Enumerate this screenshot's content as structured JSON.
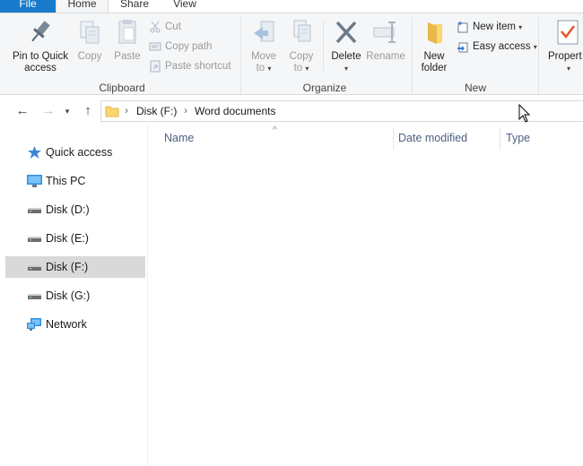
{
  "tabs": {
    "file": "File",
    "home": "Home",
    "share": "Share",
    "view": "View"
  },
  "clipboard": {
    "group_label": "Clipboard",
    "pin_label_1": "Pin to Quick",
    "pin_label_2": "access",
    "copy": "Copy",
    "paste": "Paste",
    "cut": "Cut",
    "copy_path": "Copy path",
    "paste_shortcut": "Paste shortcut"
  },
  "organize": {
    "group_label": "Organize",
    "move_to_1": "Move",
    "move_to_2": "to",
    "copy_to_1": "Copy",
    "copy_to_2": "to",
    "delete": "Delete",
    "rename": "Rename"
  },
  "new_group": {
    "group_label": "New",
    "new_folder_1": "New",
    "new_folder_2": "folder",
    "new_item": "New item",
    "easy_access": "Easy access"
  },
  "open_group": {
    "properties": "Propert"
  },
  "address": {
    "crumbs": [
      "Disk (F:)",
      "Word documents"
    ]
  },
  "navpane": {
    "items": [
      {
        "label": "Quick access",
        "icon": "star-icon"
      },
      {
        "label": "This PC",
        "icon": "monitor-icon"
      },
      {
        "label": "Disk (D:)",
        "icon": "drive-icon"
      },
      {
        "label": "Disk (E:)",
        "icon": "drive-icon"
      },
      {
        "label": "Disk (F:)",
        "icon": "drive-icon",
        "selected": true
      },
      {
        "label": "Disk (G:)",
        "icon": "drive-icon"
      },
      {
        "label": "Network",
        "icon": "network-icon"
      }
    ]
  },
  "columns": {
    "name": "Name",
    "date_modified": "Date modified",
    "type": "Type"
  },
  "colors": {
    "file_tab": "#1979ca",
    "selected_row": "#d9d9d9",
    "ribbon_bg": "#f5f6f7",
    "column_text": "#4d6082"
  }
}
